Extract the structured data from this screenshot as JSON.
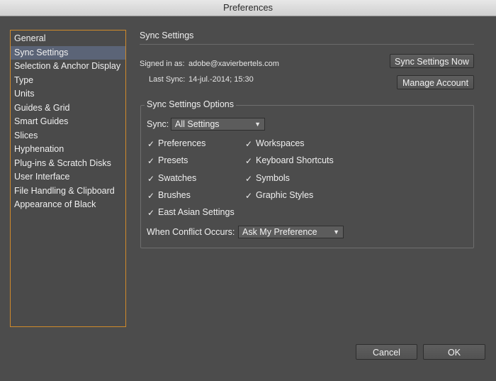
{
  "window": {
    "title": "Preferences"
  },
  "sidebar": {
    "items": [
      {
        "label": "General"
      },
      {
        "label": "Sync Settings",
        "selected": true
      },
      {
        "label": "Selection & Anchor Display"
      },
      {
        "label": "Type"
      },
      {
        "label": "Units"
      },
      {
        "label": "Guides & Grid"
      },
      {
        "label": "Smart Guides"
      },
      {
        "label": "Slices"
      },
      {
        "label": "Hyphenation"
      },
      {
        "label": "Plug-ins & Scratch Disks"
      },
      {
        "label": "User Interface"
      },
      {
        "label": "File Handling & Clipboard"
      },
      {
        "label": "Appearance of Black"
      }
    ]
  },
  "sync": {
    "title": "Sync Settings",
    "signed_in_label": "Signed in as:",
    "signed_in_value": "adobe@xavierbertels.com",
    "last_sync_label": "Last Sync:",
    "last_sync_value": "14-jul.-2014; 15:30",
    "sync_now_label": "Sync Settings Now",
    "manage_account_label": "Manage Account"
  },
  "options": {
    "title": "Sync Settings Options",
    "sync_label": "Sync:",
    "sync_value": "All Settings",
    "checks_left": [
      "Preferences",
      "Presets",
      "Swatches",
      "Brushes",
      "East Asian Settings"
    ],
    "checks_right": [
      "Workspaces",
      "Keyboard Shortcuts",
      "Symbols",
      "Graphic Styles"
    ],
    "conflict_label": "When Conflict Occurs:",
    "conflict_value": "Ask My Preference",
    "check_glyph": "✓",
    "arrow_glyph": "▼"
  },
  "footer": {
    "cancel_label": "Cancel",
    "ok_label": "OK"
  },
  "colors": {
    "sidebar_border": "#d08a2a",
    "selected_bg": "#5b6477"
  }
}
